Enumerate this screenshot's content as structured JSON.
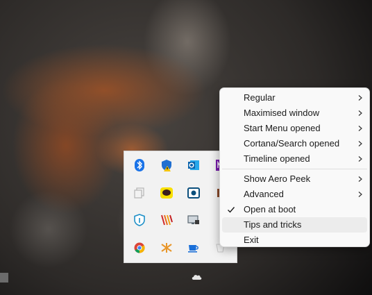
{
  "tray": {
    "icons": [
      {
        "name": "bluetooth-icon"
      },
      {
        "name": "shield-warning-icon"
      },
      {
        "name": "outlook-icon"
      },
      {
        "name": "onenote-icon"
      },
      {
        "name": "copy-icon"
      },
      {
        "name": "kakaotalk-icon"
      },
      {
        "name": "screenshot-icon"
      },
      {
        "name": "app-icon"
      },
      {
        "name": "security-shield-icon"
      },
      {
        "name": "stripes-app-icon"
      },
      {
        "name": "display-icon"
      },
      {
        "name": "app-yellow-icon"
      },
      {
        "name": "chrome-icon"
      },
      {
        "name": "orange-app-icon"
      },
      {
        "name": "coffee-icon"
      },
      {
        "name": "cup-icon"
      }
    ]
  },
  "menu": {
    "items": [
      {
        "label": "Regular",
        "submenu": true
      },
      {
        "label": "Maximised window",
        "submenu": true
      },
      {
        "label": "Start Menu opened",
        "submenu": true
      },
      {
        "label": "Cortana/Search opened",
        "submenu": true
      },
      {
        "label": "Timeline opened",
        "submenu": true
      },
      {
        "label": "Show Aero Peek",
        "submenu": true
      },
      {
        "label": "Advanced",
        "submenu": true
      },
      {
        "label": "Open at boot",
        "checked": true
      },
      {
        "label": "Tips and tricks",
        "hovered": true
      },
      {
        "label": "Exit"
      }
    ]
  }
}
